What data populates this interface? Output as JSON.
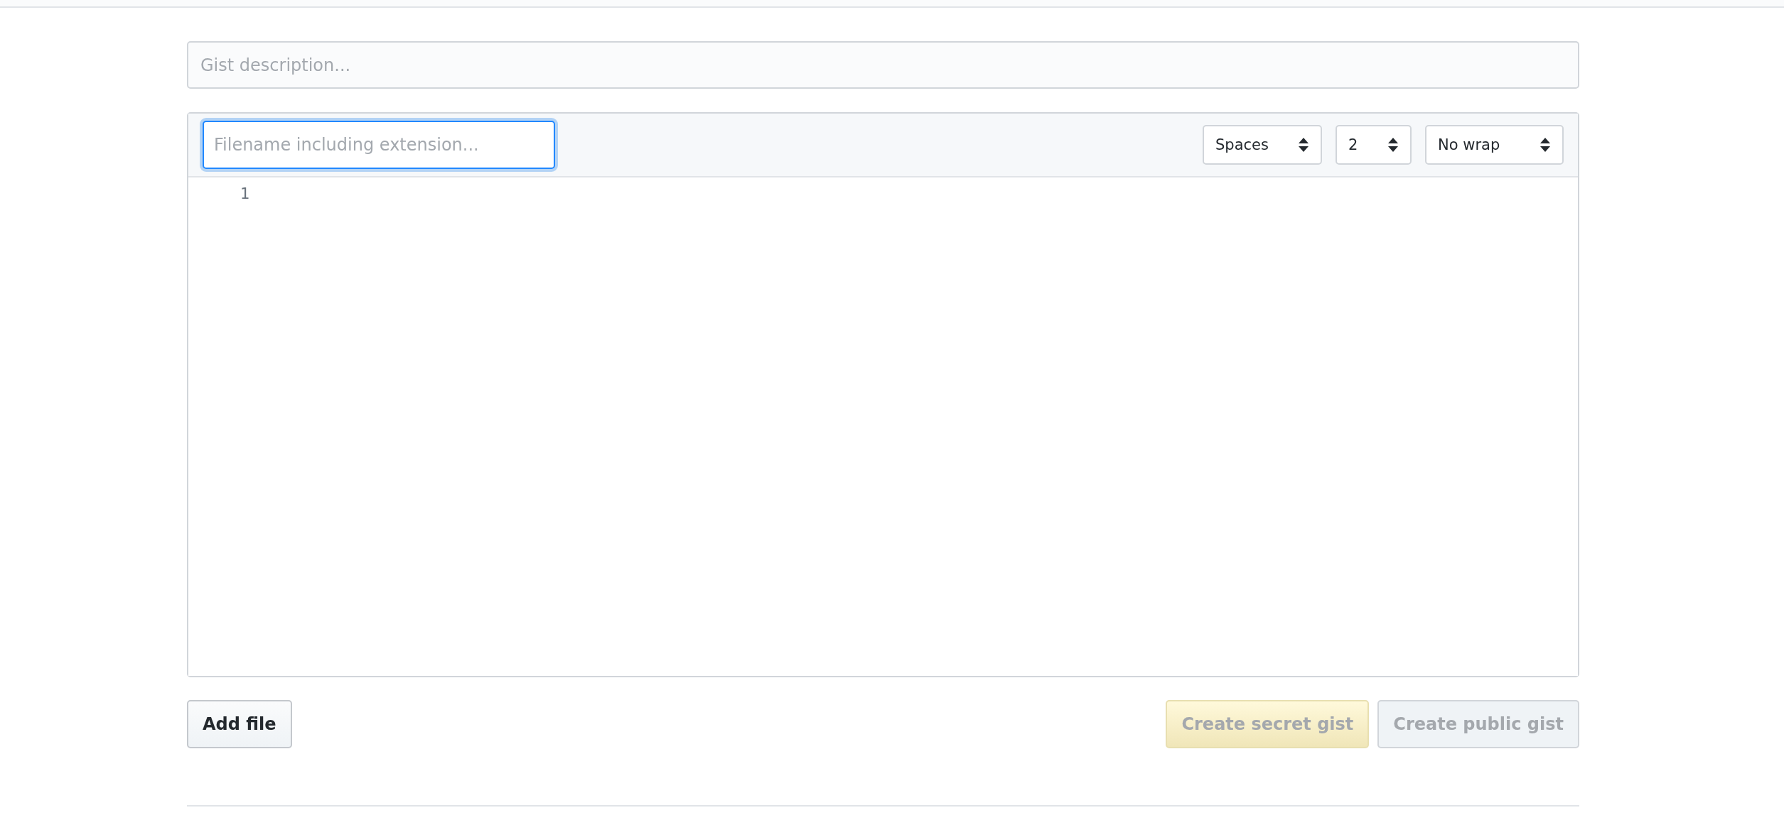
{
  "description": {
    "placeholder": "Gist description..."
  },
  "file": {
    "filename": {
      "placeholder": "Filename including extension...",
      "focused": true
    },
    "selects": [
      {
        "value": "Spaces"
      },
      {
        "value": "2"
      },
      {
        "value": "No wrap"
      }
    ],
    "line_numbers": [
      "1"
    ]
  },
  "buttons": [
    {
      "label": "Add file",
      "kind": "default",
      "disabled": false
    },
    {
      "label": "Create secret gist",
      "kind": "secret",
      "disabled": true
    },
    {
      "label": "Create public gist",
      "kind": "default",
      "disabled": true
    }
  ]
}
